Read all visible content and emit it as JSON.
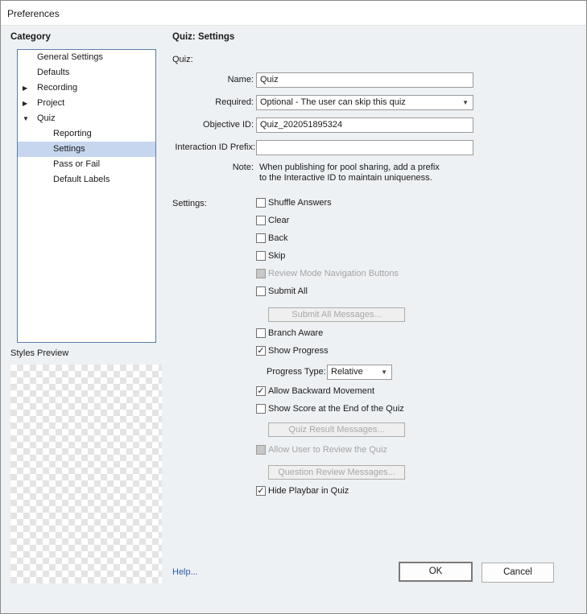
{
  "window": {
    "title": "Preferences"
  },
  "category": {
    "heading": "Category",
    "items": [
      {
        "label": "General Settings",
        "arrow": ""
      },
      {
        "label": "Defaults",
        "arrow": ""
      },
      {
        "label": "Recording",
        "arrow": "▶"
      },
      {
        "label": "Project",
        "arrow": "▶"
      },
      {
        "label": "Quiz",
        "arrow": "▼"
      },
      {
        "label": "Reporting",
        "arrow": ""
      },
      {
        "label": "Settings",
        "arrow": ""
      },
      {
        "label": "Pass or Fail",
        "arrow": ""
      },
      {
        "label": "Default Labels",
        "arrow": ""
      }
    ],
    "selected": "Settings"
  },
  "styles_preview": {
    "label": "Styles Preview"
  },
  "panel": {
    "title": "Quiz: Settings",
    "quiz_group": "Quiz:",
    "name": {
      "label": "Name:",
      "value": "Quiz"
    },
    "required": {
      "label": "Required:",
      "value": "Optional - The user can skip this quiz"
    },
    "objective_id": {
      "label": "Objective ID:",
      "value": "Quiz_202051895324"
    },
    "interaction_prefix": {
      "label": "Interaction ID Prefix:",
      "value": ""
    },
    "note": {
      "label": "Note:",
      "line1": "When publishing for pool sharing, add a prefix",
      "line2": "to the Interactive ID to maintain uniqueness."
    },
    "settings_label": "Settings:",
    "checkboxes": {
      "shuffle": {
        "label": "Shuffle Answers",
        "mark": ""
      },
      "clear": {
        "label": "Clear",
        "mark": ""
      },
      "back": {
        "label": "Back",
        "mark": ""
      },
      "skip": {
        "label": "Skip",
        "mark": ""
      },
      "review_nav": {
        "label": "Review Mode Navigation Buttons",
        "mark": ""
      },
      "submit_all": {
        "label": "Submit All",
        "mark": ""
      },
      "branch_aware": {
        "label": "Branch Aware",
        "mark": ""
      },
      "show_progress": {
        "label": "Show Progress",
        "mark": "✓"
      },
      "allow_backward": {
        "label": "Allow Backward Movement",
        "mark": "✓"
      },
      "show_score": {
        "label": "Show Score at the End of the Quiz",
        "mark": ""
      },
      "allow_review": {
        "label": "Allow User to Review the Quiz",
        "mark": ""
      },
      "hide_playbar": {
        "label": "Hide Playbar in Quiz",
        "mark": "✓"
      }
    },
    "submit_all_messages": "Submit All Messages...",
    "progress_type": {
      "label": "Progress Type:",
      "value": "Relative"
    },
    "quiz_result_messages": "Quiz Result Messages...",
    "question_review_messages": "Question Review Messages..."
  },
  "footer": {
    "help": "Help...",
    "ok": "OK",
    "cancel": "Cancel"
  },
  "icons": {
    "dropdown": "▼"
  }
}
